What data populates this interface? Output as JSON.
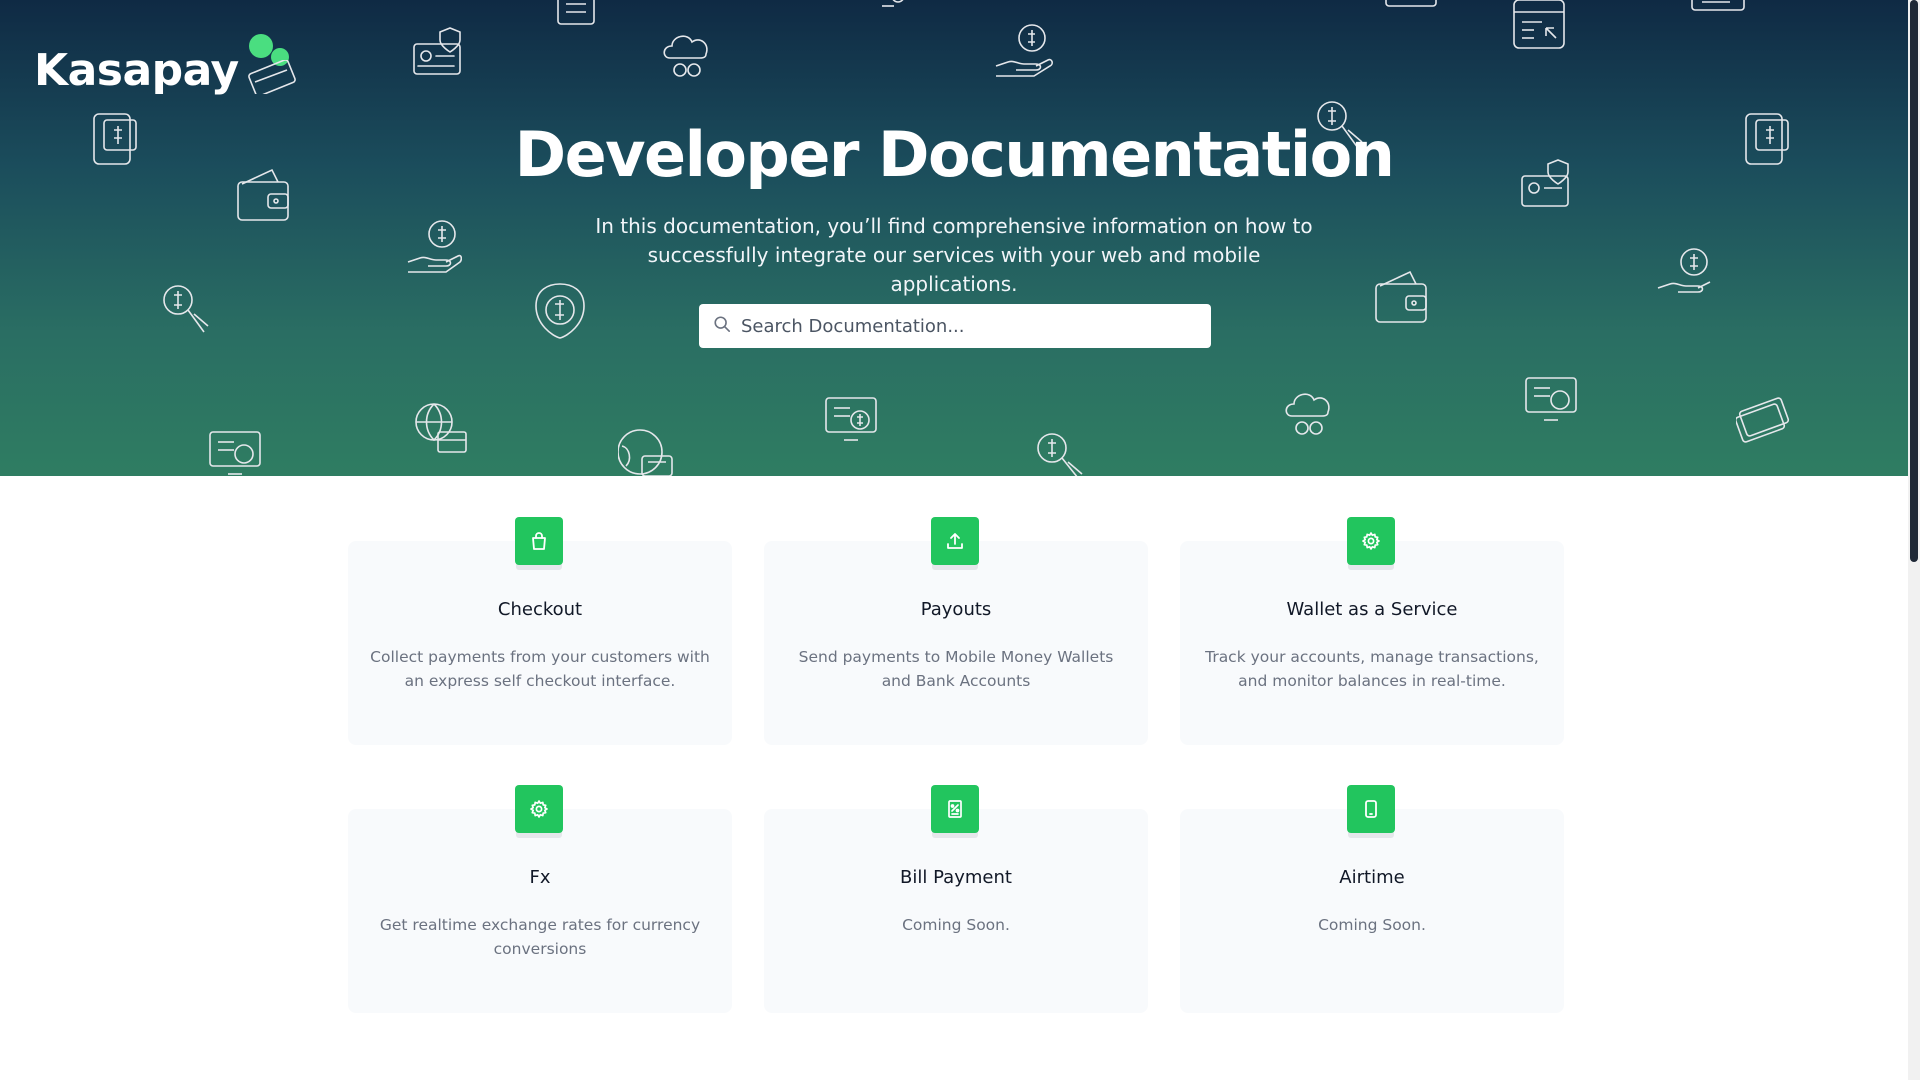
{
  "brand": {
    "name": "Kasapay",
    "accent": "#22c55e",
    "logo_dot_color": "#4ade80"
  },
  "hero": {
    "title": "Developer Documentation",
    "subtitle": "In this documentation, you’ll find comprehensive information on how to successfully integrate our services with your web and mobile applications.",
    "gradient_colors": [
      "#0f2a44",
      "#2f7d62"
    ]
  },
  "search": {
    "placeholder": "Search Documentation...",
    "icon": "search-icon"
  },
  "cards": [
    {
      "title": "Checkout",
      "description": "Collect payments from your customers with an express self checkout interface.",
      "icon": "shopping-bag-icon"
    },
    {
      "title": "Payouts",
      "description": "Send payments to Mobile Money Wallets and Bank Accounts",
      "icon": "upload-icon"
    },
    {
      "title": "Wallet as a Service",
      "description": "Track your accounts, manage transactions, and monitor balances in real-time.",
      "icon": "gear-icon"
    },
    {
      "title": "Fx",
      "description": "Get realtime exchange rates for currency conversions",
      "icon": "gear-icon"
    },
    {
      "title": "Bill Payment",
      "description": "Coming Soon.",
      "icon": "receipt-icon"
    },
    {
      "title": "Airtime",
      "description": "Coming Soon.",
      "icon": "phone-icon"
    }
  ]
}
